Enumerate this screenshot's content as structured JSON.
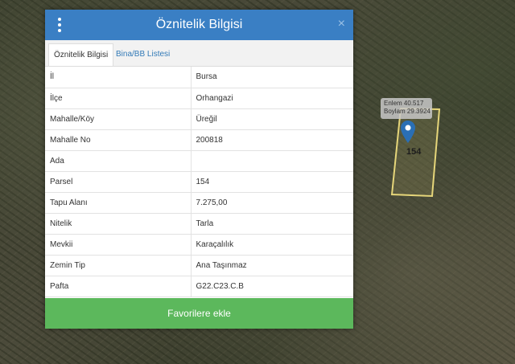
{
  "map": {
    "coords": {
      "enlem_label": "Enlem",
      "enlem_value": "40.517",
      "boylam_label": "Boylam",
      "boylam_value": "29.3924"
    },
    "parcel_label": "154"
  },
  "panel": {
    "title": "Öznitelik Bilgisi",
    "close": "×",
    "tabs": [
      {
        "label": "Öznitelik Bilgisi"
      },
      {
        "label": "Bina/BB Listesi"
      }
    ],
    "rows": [
      {
        "key": "İl",
        "value": "Bursa"
      },
      {
        "key": "İlçe",
        "value": "Orhangazi"
      },
      {
        "key": "Mahalle/Köy",
        "value": "Üreğil"
      },
      {
        "key": "Mahalle No",
        "value": "200818"
      },
      {
        "key": "Ada",
        "value": ""
      },
      {
        "key": "Parsel",
        "value": "154"
      },
      {
        "key": "Tapu Alanı",
        "value": "7.275,00"
      },
      {
        "key": "Nitelik",
        "value": "Tarla"
      },
      {
        "key": "Mevkii",
        "value": "Karaçalılık"
      },
      {
        "key": "Zemin Tip",
        "value": "Ana Taşınmaz"
      },
      {
        "key": "Pafta",
        "value": "G22.C23.C.B"
      }
    ],
    "favorite_button": "Favorilere ekle"
  },
  "colors": {
    "header": "#3a7fc4",
    "button": "#5cb85c",
    "parcel_outline": "#e6d67a",
    "pin": "#2a6fb5"
  }
}
